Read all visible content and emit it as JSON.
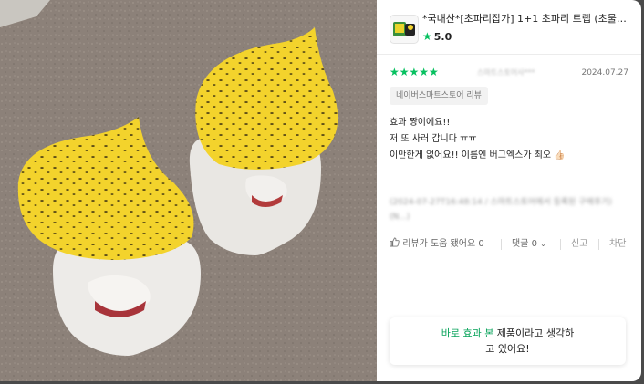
{
  "product": {
    "title": "*국내산*[초파리잡가] 1+1 초파리 트랩 (초물모...",
    "rating": "5.0",
    "star_icon": "star-icon"
  },
  "review": {
    "stars": "★★★★★",
    "reviewer": "스마트스토어사***",
    "date": "2024.07.27",
    "source_tag": "네이버스마트스토어 리뷰",
    "lines": [
      "효과 짱이에요!!",
      "저 또 사러 갑니다 ㅠㅠ",
      "이만한게 없어요!! 이름엔 버그엑스가 최오 👍🏻"
    ],
    "blurred_meta": "(2024-07-27T16:48:14 / 스마트스토어에서 등록된 구매후기) (N...)",
    "helpful_label": "리뷰가 도움 됐어요",
    "helpful_count": "0",
    "comments_label": "댓글 0",
    "report_label": "신고",
    "block_label": "차단"
  },
  "summary": {
    "highlight": "바로 효과 본",
    "rest_line1": " 제품이라고 생각하",
    "line2": "고 있어요!"
  },
  "colors": {
    "accent": "#07c160",
    "highlight": "#07a35a",
    "photo_bg": "#8a7e76",
    "trap_yellow": "#f3d32c"
  }
}
